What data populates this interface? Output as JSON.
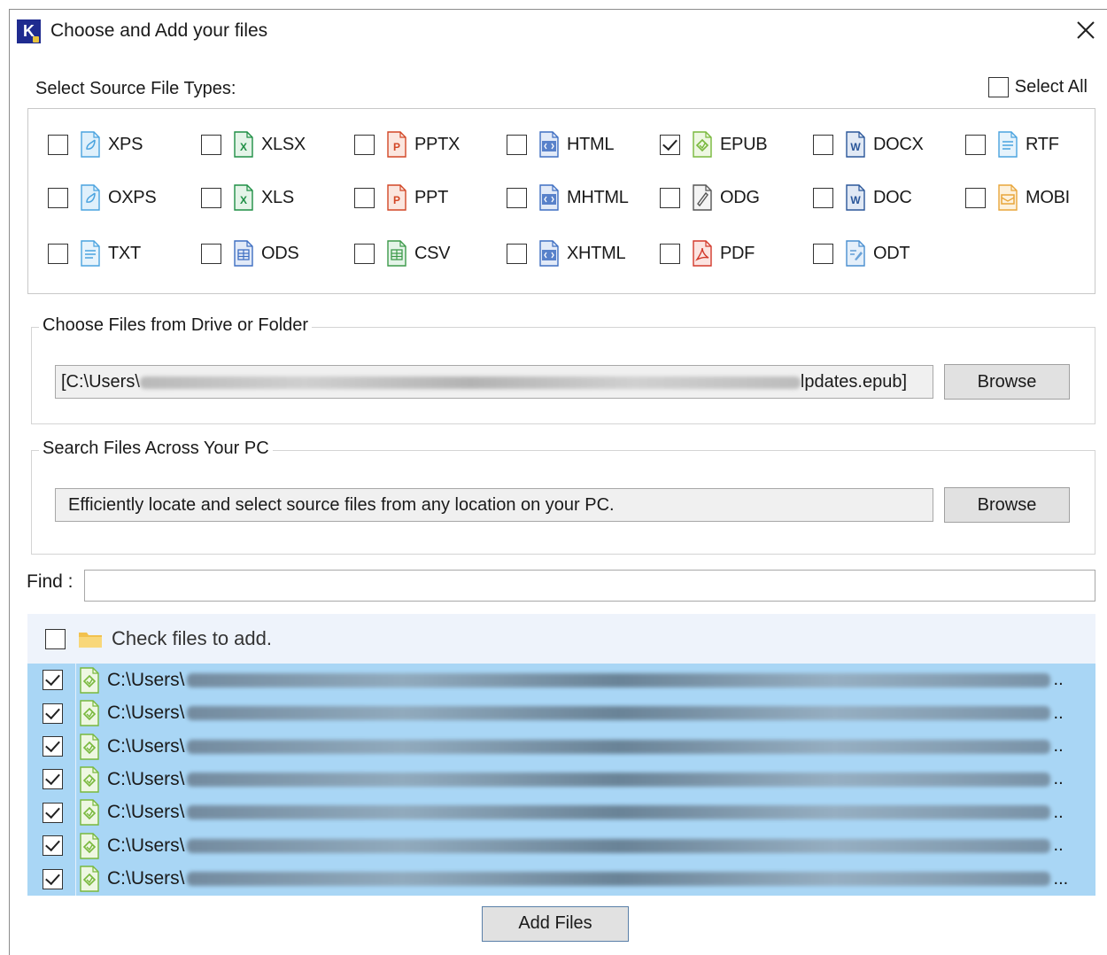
{
  "window": {
    "title": "Choose and Add your files",
    "logo_letter": "K"
  },
  "source_types": {
    "label": "Select Source File Types:",
    "select_all_label": "Select All",
    "select_all_checked": false,
    "items": [
      {
        "label": "XPS",
        "icon": "xps-file-icon",
        "checked": false
      },
      {
        "label": "XLSX",
        "icon": "excel-file-icon",
        "checked": false
      },
      {
        "label": "PPTX",
        "icon": "powerpoint-file-icon",
        "checked": false
      },
      {
        "label": "HTML",
        "icon": "html-file-icon",
        "checked": false
      },
      {
        "label": "EPUB",
        "icon": "epub-file-icon",
        "checked": true
      },
      {
        "label": "DOCX",
        "icon": "word-file-icon",
        "checked": false
      },
      {
        "label": "RTF",
        "icon": "rtf-file-icon",
        "checked": false
      },
      {
        "label": "OXPS",
        "icon": "xps-file-icon",
        "checked": false
      },
      {
        "label": "XLS",
        "icon": "excel-file-icon",
        "checked": false
      },
      {
        "label": "PPT",
        "icon": "powerpoint-file-icon",
        "checked": false
      },
      {
        "label": "MHTML",
        "icon": "html-file-icon",
        "checked": false
      },
      {
        "label": "ODG",
        "icon": "odg-file-icon",
        "checked": false
      },
      {
        "label": "DOC",
        "icon": "word-file-icon",
        "checked": false
      },
      {
        "label": "MOBI",
        "icon": "mobi-file-icon",
        "checked": false
      },
      {
        "label": "TXT",
        "icon": "text-file-icon",
        "checked": false
      },
      {
        "label": "ODS",
        "icon": "ods-file-icon",
        "checked": false
      },
      {
        "label": "CSV",
        "icon": "csv-file-icon",
        "checked": false
      },
      {
        "label": "XHTML",
        "icon": "html-file-icon",
        "checked": false
      },
      {
        "label": "PDF",
        "icon": "pdf-file-icon",
        "checked": false
      },
      {
        "label": "ODT",
        "icon": "odt-file-icon",
        "checked": false
      }
    ]
  },
  "drive_group": {
    "title": "Choose Files from Drive or Folder",
    "path_prefix": "[C:\\Users\\",
    "path_suffix": "lpdates.epub]",
    "browse_label": "Browse"
  },
  "search_group": {
    "title": "Search Files Across Your PC",
    "field_text": "Efficiently locate and select source files from any location on your PC.",
    "browse_label": "Browse"
  },
  "find": {
    "label": "Find :",
    "value": ""
  },
  "file_list": {
    "header_label": "Check files to add.",
    "header_checked": false,
    "rows": [
      {
        "path_prefix": "C:\\Users\\",
        "ellipsis": "..",
        "checked": true
      },
      {
        "path_prefix": "C:\\Users\\",
        "ellipsis": "..",
        "checked": true
      },
      {
        "path_prefix": "C:\\Users\\",
        "ellipsis": "..",
        "checked": true
      },
      {
        "path_prefix": "C:\\Users\\",
        "ellipsis": "..",
        "checked": true
      },
      {
        "path_prefix": "C:\\Users\\",
        "ellipsis": "..",
        "checked": true
      },
      {
        "path_prefix": "C:\\Users\\",
        "ellipsis": "..",
        "checked": true
      },
      {
        "path_prefix": "C:\\Users\\",
        "ellipsis": "...",
        "checked": true
      }
    ]
  },
  "add_button_label": "Add Files",
  "colors": {
    "selection": "#a9d6f5",
    "list_header": "#eef3fb",
    "logo": "#1f2b8f",
    "button": "#e1e1e1"
  }
}
